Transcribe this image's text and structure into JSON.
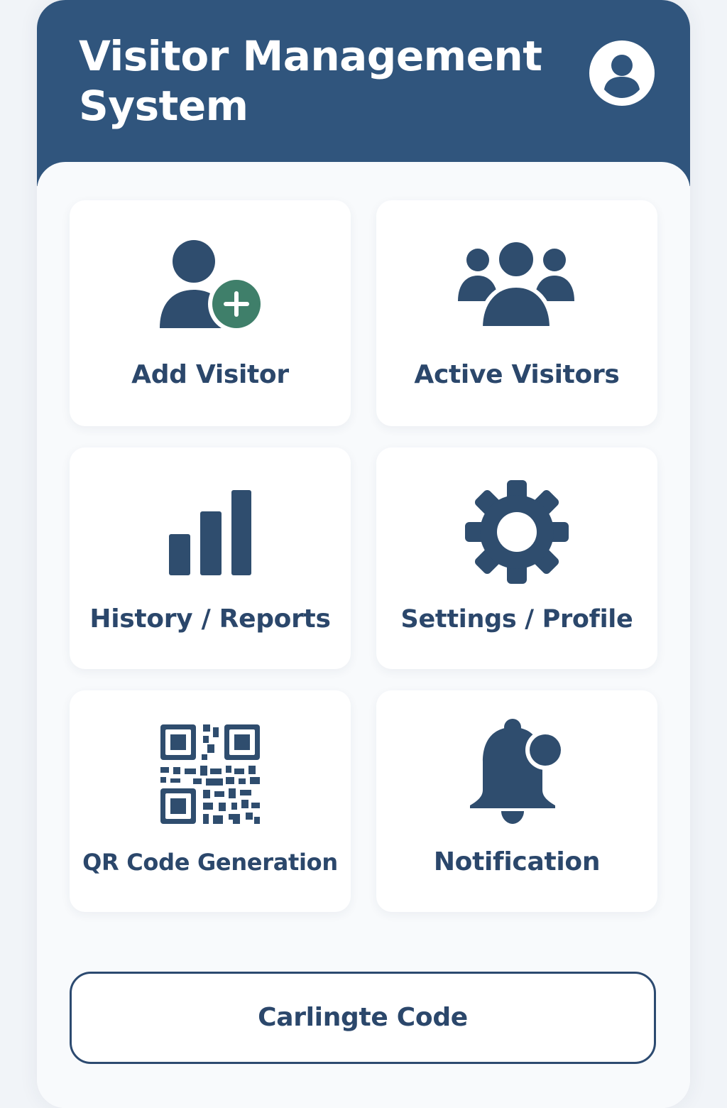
{
  "app": {
    "title_line1": "Visitor Management",
    "title_line2": "System"
  },
  "header": {
    "profile_icon": "user-circle-icon"
  },
  "cards": [
    {
      "label": "Add Visitor",
      "icon": "add-user-icon"
    },
    {
      "label": "Active Visitors",
      "icon": "users-group-icon"
    },
    {
      "label": "History / Reports",
      "icon": "bar-chart-icon"
    },
    {
      "label": "Settings / Profile",
      "icon": "gear-icon"
    },
    {
      "label": "QR Code Generation",
      "icon": "qr-code-icon"
    },
    {
      "label": "Notification",
      "icon": "bell-icon"
    }
  ],
  "footer": {
    "button_label": "Carlingte Code"
  },
  "colors": {
    "header_bg": "#30557d",
    "icon": "#2f4d6e",
    "accent_green": "#3f7f6a",
    "text": "#2b476b",
    "page_bg": "#f1f4f8"
  }
}
